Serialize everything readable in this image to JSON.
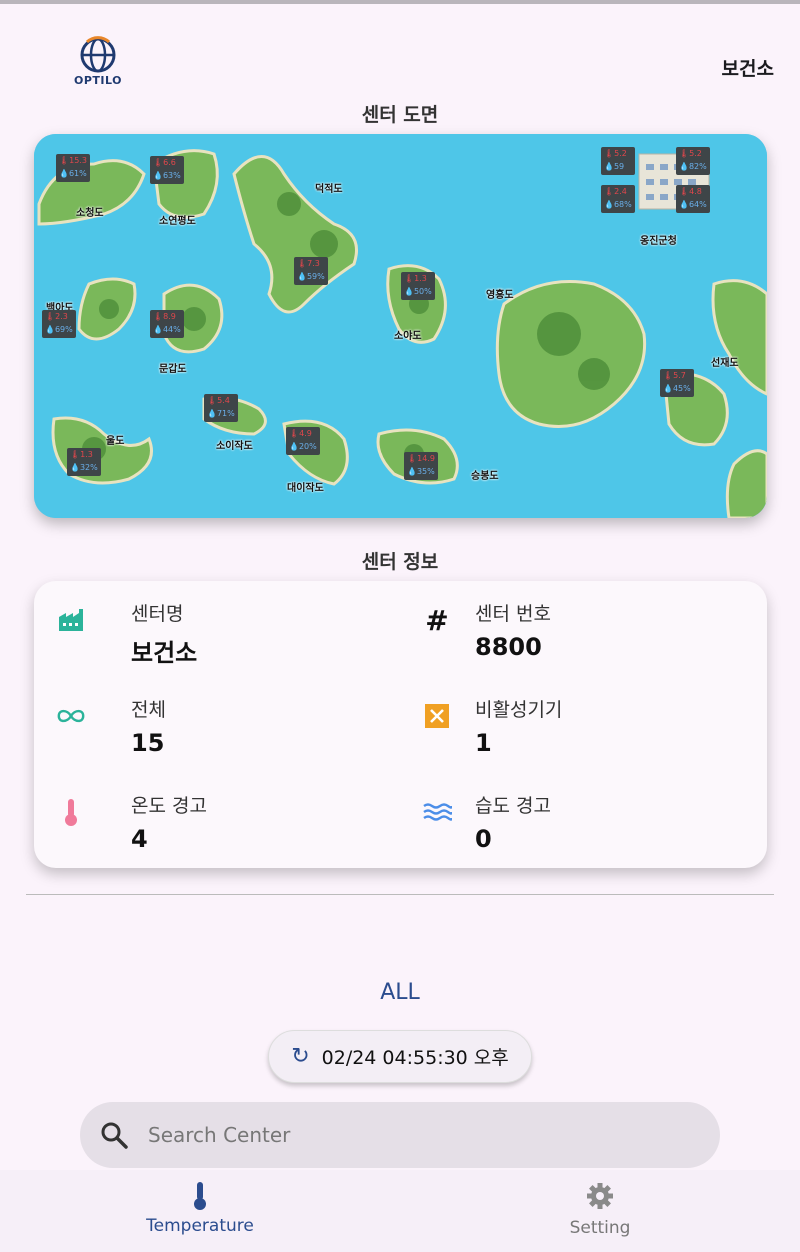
{
  "header": {
    "brand": "OPTILO",
    "center_name": "보건소"
  },
  "map_section": {
    "title": "센터 도면",
    "islands": [
      "소청도",
      "소연평도",
      "덕적도",
      "백아도",
      "문갑도",
      "울도",
      "소이작도",
      "대이작도",
      "소야도",
      "영흥도",
      "승봉도",
      "선재도",
      "옹진군청"
    ],
    "sensors": [
      {
        "temp": "15.3",
        "hum": "61%"
      },
      {
        "temp": "6.6",
        "hum": "63%"
      },
      {
        "temp": "7.3",
        "hum": "59%"
      },
      {
        "temp": "2.3",
        "hum": "69%"
      },
      {
        "temp": "8.9",
        "hum": "44%"
      },
      {
        "temp": "1.3",
        "hum": "50%"
      },
      {
        "temp": "5.4",
        "hum": "71%"
      },
      {
        "temp": "1.3",
        "hum": "32%"
      },
      {
        "temp": "4.9",
        "hum": "20%"
      },
      {
        "temp": "14.9",
        "hum": "35%"
      },
      {
        "temp": "5.7",
        "hum": "45%"
      },
      {
        "temp": "5.2",
        "hum": "59"
      },
      {
        "temp": "5.2",
        "hum": "82%"
      },
      {
        "temp": "2.4",
        "hum": "68%"
      },
      {
        "temp": "4.8",
        "hum": "64%"
      }
    ]
  },
  "info_section": {
    "title": "센터 정보",
    "center_name_label": "센터명",
    "center_name_value": "보건소",
    "center_no_label": "센터 번호",
    "center_no_value": "8800",
    "total_label": "전체",
    "total_value": "15",
    "inactive_label": "비활성기기",
    "inactive_value": "1",
    "temp_warn_label": "온도 경고",
    "temp_warn_value": "4",
    "hum_warn_label": "습도 경고",
    "hum_warn_value": "0"
  },
  "filter": {
    "label": "ALL"
  },
  "refresh": {
    "timestamp": "02/24 04:55:30 오후"
  },
  "search": {
    "placeholder": "Search Center",
    "value": ""
  },
  "nav": {
    "temperature_label": "Temperature",
    "setting_label": "Setting"
  },
  "colors": {
    "accent": "#2b4c8e",
    "teal": "#2bb39a",
    "warning_orange": "#f0a023",
    "pink": "#f07a9a",
    "wave_blue": "#4c8ee8",
    "sea": "#4ec6e8"
  }
}
